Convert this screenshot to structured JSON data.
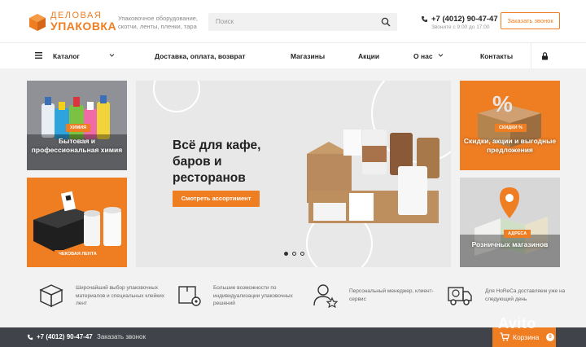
{
  "header": {
    "logo_line1": "ДЕЛОВАЯ",
    "logo_line2": "УПАКОВКА",
    "tagline": "Упаковочное оборудование, скотчи, ленты, пленки, тара",
    "search_placeholder": "Поиск",
    "phone": "+7 (4012) 90-47-47",
    "hours": "Звоните с 9:00 до 17:00",
    "call_button": "Заказать звонок",
    "brand_color": "#ef7d22"
  },
  "nav": {
    "items": [
      {
        "label": "Каталог"
      },
      {
        "label": "Доставка, оплата, возврат"
      },
      {
        "label": "Магазины"
      },
      {
        "label": "Акции"
      },
      {
        "label": "О нас"
      },
      {
        "label": "Контакты"
      }
    ]
  },
  "tiles": {
    "chemistry": {
      "tag": "ХИМИЯ",
      "label": "Бытовая и профессиональная химия"
    },
    "receipt": {
      "tag": "ЧЕКОВАЯ ЛЕНТА"
    },
    "discounts": {
      "tag": "СКИДКИ %",
      "label": "Скидки, акции и выгодные предложения"
    },
    "stores": {
      "tag": "АДРЕСА",
      "label": "Розничных магазинов"
    }
  },
  "hero": {
    "title": "Всё для кафе, баров и ресторанов",
    "button": "Смотреть ассортимент",
    "slides_total": 3,
    "active_slide": 1
  },
  "features": [
    {
      "icon": "box-icon",
      "text": "Широчайший выбор упаковочных материалов и специальных клейких лент"
    },
    {
      "icon": "box-gear-icon",
      "text": "Большие возможности по индивидуализации упаковочных решений"
    },
    {
      "icon": "manager-star-icon",
      "text": "Персональный менеджер, клиент-сервис"
    },
    {
      "icon": "delivery-truck-icon",
      "text": "Для HoReCa доставляем уже на следующий день"
    }
  ],
  "bottombar": {
    "phone": "+7 (4012) 90-47-47",
    "call": "Заказать звонок",
    "cart_label": "Корзина",
    "cart_count": "0"
  },
  "watermark": "Avito"
}
